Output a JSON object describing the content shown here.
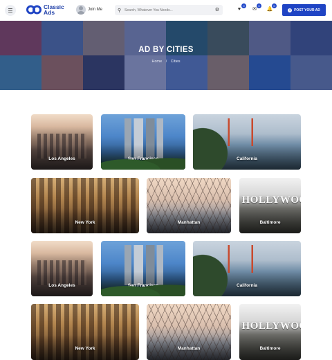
{
  "header": {
    "logo_line1": "Classic",
    "logo_line2": "Ads",
    "join_label": "Join Me",
    "search_placeholder": "Search, Whatever You Needs...",
    "badges": {
      "favorites": "0",
      "messages": "0",
      "notifications": "0"
    },
    "post_button": "POST YOUR AD"
  },
  "hero": {
    "title": "AD BY CITIES",
    "breadcrumb": [
      "Home",
      "/",
      "Cities"
    ]
  },
  "cities": [
    {
      "name": "Los Angeles"
    },
    {
      "name": "San Francisco"
    },
    {
      "name": "California"
    },
    {
      "name": "New York"
    },
    {
      "name": "Manhattan"
    },
    {
      "name": "Baltimore"
    },
    {
      "name": "Los Angeles"
    },
    {
      "name": "San Francisco"
    },
    {
      "name": "California"
    },
    {
      "name": "New York"
    },
    {
      "name": "Manhattan"
    },
    {
      "name": "Baltimore"
    }
  ],
  "colors": {
    "brand": "#1f44c4",
    "hero_overlay": "#1e2e78"
  },
  "icons": {
    "menu": "hamburger-icon",
    "search": "search-icon",
    "filter": "filter-icon",
    "favorites": "heart-icon",
    "messages": "mail-icon",
    "notifications": "bell-icon",
    "post": "plus-circle-icon"
  }
}
